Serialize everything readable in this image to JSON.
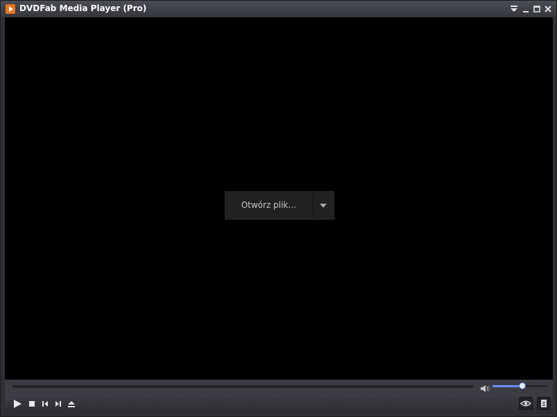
{
  "window": {
    "title": "DVDFab Media Player (Pro)"
  },
  "titlebar_buttons": [
    {
      "icon": "menu-dropdown-icon"
    },
    {
      "icon": "minimize-icon"
    },
    {
      "icon": "maximize-icon"
    },
    {
      "icon": "close-icon"
    }
  ],
  "open": {
    "label": "Otwórz plik…",
    "dropdown_icon": "chevron-down-icon"
  },
  "playback": {
    "progress_fraction": 0.0
  },
  "volume": {
    "level_fraction": 0.54,
    "accent": "#6b8cff"
  },
  "controls": [
    {
      "icon": "play-icon"
    },
    {
      "icon": "stop-icon"
    },
    {
      "icon": "previous-icon"
    },
    {
      "icon": "next-icon"
    },
    {
      "icon": "eject-icon"
    }
  ],
  "side_buttons": [
    {
      "icon": "eye-icon"
    },
    {
      "icon": "playlist-icon"
    }
  ],
  "colors": {
    "app_logo": "#e8741c",
    "video_background": "#000000",
    "titlebar": "#3b3e45"
  }
}
